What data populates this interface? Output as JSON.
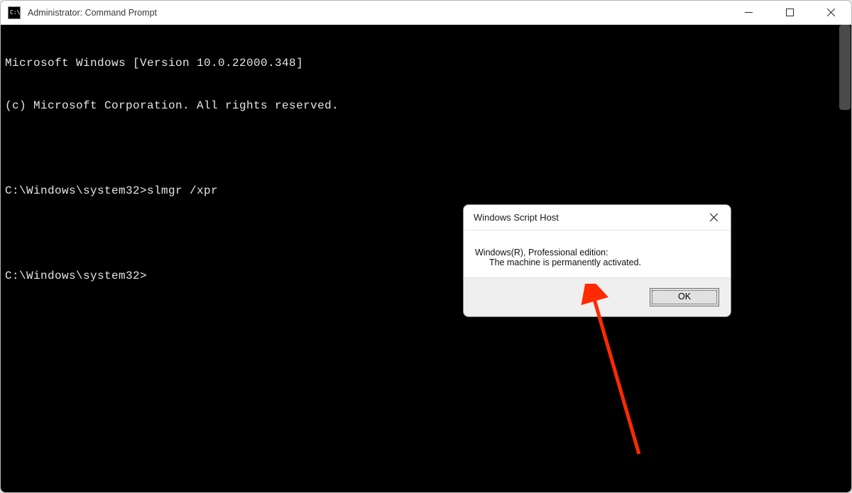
{
  "window": {
    "title": "Administrator: Command Prompt",
    "icon_label": "cmd-icon",
    "icon_text": "C:\\"
  },
  "console": {
    "line1": "Microsoft Windows [Version 10.0.22000.348]",
    "line2": "(c) Microsoft Corporation. All rights reserved.",
    "blank1": "",
    "line3_prompt": "C:\\Windows\\system32>",
    "line3_cmd": "slmgr /xpr",
    "blank2": "",
    "line4_prompt": "C:\\Windows\\system32>"
  },
  "dialog": {
    "title": "Windows Script Host",
    "message_line1": "Windows(R), Professional edition:",
    "message_line2": "The machine is permanently activated.",
    "ok_label": "OK"
  }
}
